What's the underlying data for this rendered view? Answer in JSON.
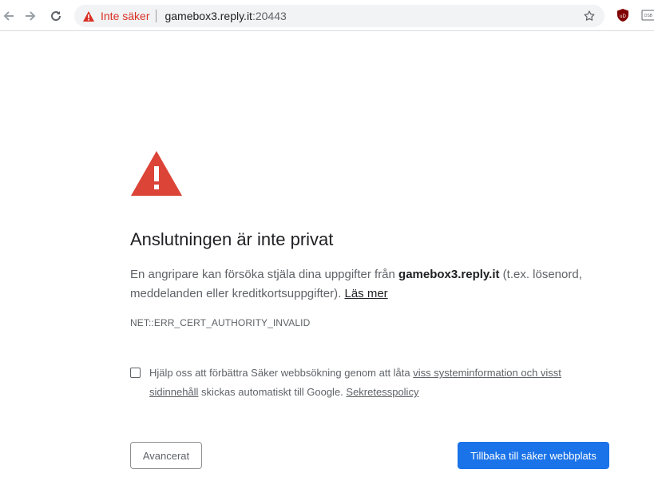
{
  "browser": {
    "security_label": "Inte säker",
    "url_host": "gamebox3.reply.it",
    "url_port": ":20443",
    "extension_ublock_label": "uD",
    "extension_other_label": "DSB"
  },
  "interstitial": {
    "title": "Anslutningen är inte privat",
    "desc_before": "En angripare kan försöka stjäla dina uppgifter från ",
    "desc_host": "gamebox3.reply.it",
    "desc_after": " (t.ex. lösenord, meddelanden eller kreditkortsuppgifter). ",
    "learn_more": "Läs mer",
    "error_code": "NET::ERR_CERT_AUTHORITY_INVALID",
    "optin_before": "Hjälp oss att förbättra Säker webbsökning genom att låta ",
    "optin_link": "viss systeminformation och visst sidinnehåll",
    "optin_middle": " skickas automatiskt till Google. ",
    "privacy_link": "Sekretesspolicy",
    "advanced_button": "Avancerat",
    "back_button": "Tillbaka till säker webbplats"
  },
  "colors": {
    "warning_red": "#d93025",
    "primary_blue": "#1a73e8"
  }
}
